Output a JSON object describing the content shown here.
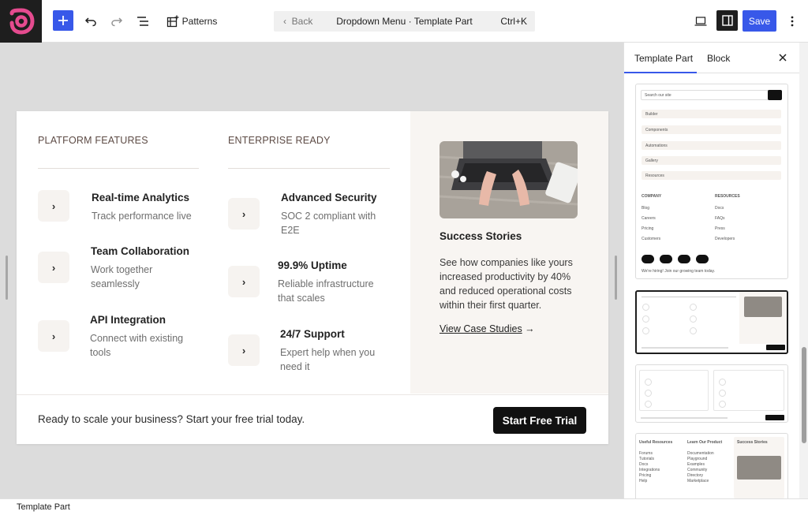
{
  "toolbar": {
    "patterns_label": "Patterns",
    "back_label": "Back",
    "document_title": "Dropdown Menu · Template Part",
    "shortcut": "Ctrl+K",
    "save_label": "Save",
    "logo_color": "#e54b8f",
    "accent_color": "#3858e9"
  },
  "canvas": {
    "columns": [
      {
        "heading": "PLATFORM FEATURES",
        "features": [
          {
            "title": "Real-time Analytics",
            "desc": "Track performance live"
          },
          {
            "title": "Team Collaboration",
            "desc": "Work together seamlessly"
          },
          {
            "title": "API Integration",
            "desc": "Connect with existing tools"
          }
        ]
      },
      {
        "heading": "ENTERPRISE READY",
        "features": [
          {
            "title": "Advanced Security",
            "desc": "SOC 2 compliant with E2E"
          },
          {
            "title": "99.9% Uptime",
            "desc": "Reliable infrastructure that scales"
          },
          {
            "title": "24/7 Support",
            "desc": "Expert help when you need it"
          }
        ]
      }
    ],
    "feature_icon": "›",
    "promo": {
      "title": "Success Stories",
      "desc": "See how companies like yours increased productivity by 40% and reduced operational costs within their first quarter.",
      "link": "View Case Studies",
      "link_arrow": "→"
    },
    "cta": {
      "text": "Ready to scale your business? Start your free trial today.",
      "button": "Start Free Trial"
    }
  },
  "sidebar": {
    "tabs": [
      "Template Part",
      "Block"
    ],
    "card1": {
      "search_placeholder": "Search our site",
      "menu": [
        "Builder",
        "Components",
        "Automations",
        "Gallery",
        "Resources"
      ],
      "company_heading": "COMPANY",
      "company_links": [
        "Blog",
        "Careers",
        "Pricing",
        "Customers"
      ],
      "resources_heading": "RESOURCES",
      "resources_links": [
        "Docs",
        "FAQs",
        "Press",
        "Developers"
      ],
      "footer_text": "We're hiring! Join our growing team today."
    },
    "card4": {
      "col1_heading": "Useful Resources",
      "col1_links": [
        "Forums",
        "Tutorials",
        "Docs",
        "Integrations",
        "Pricing",
        "Help"
      ],
      "col2_heading": "Learn Our Product",
      "col2_links": [
        "Documentation",
        "Playground",
        "Examples",
        "Community",
        "Directory",
        "Marketplace"
      ],
      "promo_heading": "Success Stories"
    }
  },
  "statusbar": {
    "breadcrumb": "Template Part"
  }
}
